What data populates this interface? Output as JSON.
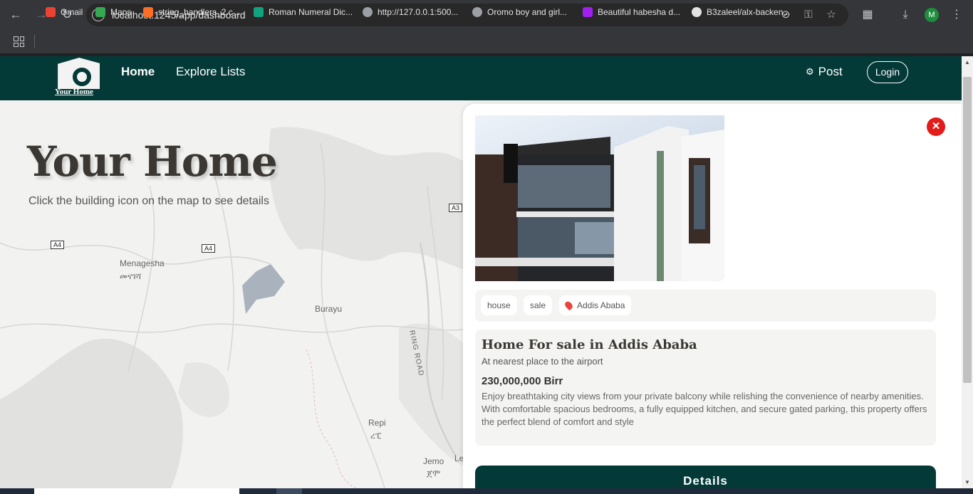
{
  "browser": {
    "url": "localhost:1245/app/dashboard",
    "avatar_letter": "M",
    "bookmarks": [
      {
        "label": "Gmail",
        "color": "#ea4335"
      },
      {
        "label": "Maps",
        "color": "#34a853"
      },
      {
        "label": "string_handlers_2.c ...",
        "color": "#fc6d26"
      },
      {
        "label": "Roman Numeral Dic...",
        "color": "#10a37f"
      },
      {
        "label": "http://127.0.0.1:500...",
        "color": "#9aa0a6"
      },
      {
        "label": "Oromo boy and girl...",
        "color": "#9aa0a6"
      },
      {
        "label": "Beautiful habesha d...",
        "color": "#a020f0"
      },
      {
        "label": "B3zaleel/alx-backen...",
        "color": "#e3e3e3"
      }
    ]
  },
  "site": {
    "logo_caption": "Your Home",
    "nav": {
      "home": "Home",
      "explore": "Explore Lists",
      "post": "Post",
      "login": "Login"
    }
  },
  "hero": {
    "title": "Your Home",
    "subtitle": "Click the building icon on the map to see details"
  },
  "map": {
    "shields": [
      "A4",
      "A4",
      "A3"
    ],
    "places": [
      "Menagesha",
      "መናገሻ",
      "Burayu",
      "RING ROAD",
      "Repi",
      "ረፒ",
      "Jemo",
      "ጀሞ",
      "Le"
    ]
  },
  "listing": {
    "tags": {
      "type": "house",
      "purpose": "sale",
      "location": "Addis Ababa"
    },
    "title": "Home For sale in Addis Ababa",
    "subtitle": "At nearest place to the airport",
    "price": "230,000,000 Birr",
    "description": "Enjoy breathtaking city views from your private balcony while relishing the convenience of nearby amenities. With comfortable spacious bedrooms, a fully equipped kitchen, and secure gated parking, this property offers the perfect blend of comfort and style",
    "details_label": "Details"
  }
}
